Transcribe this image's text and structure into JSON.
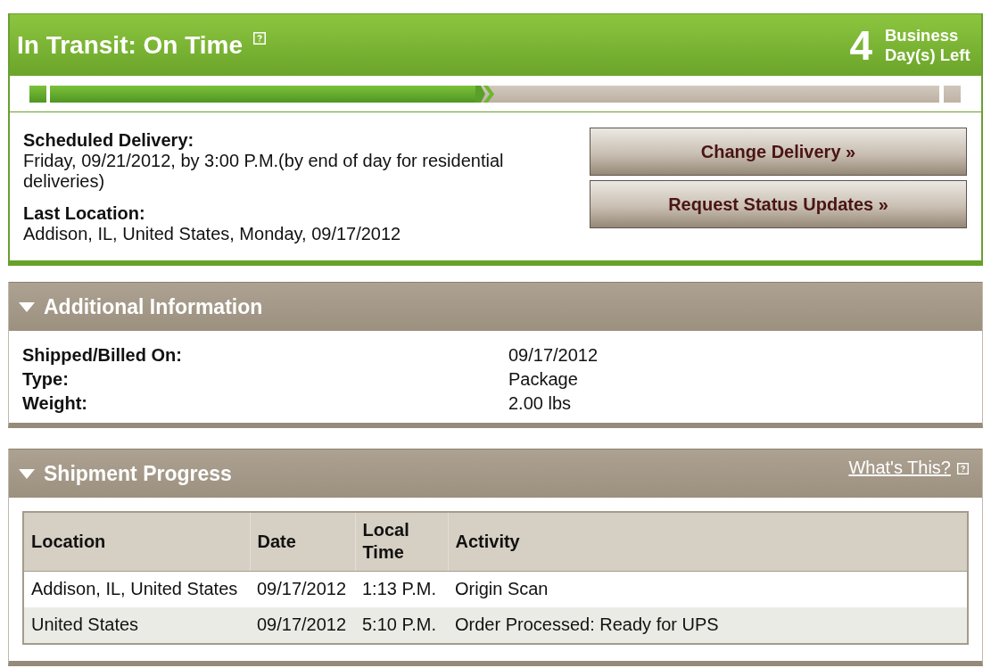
{
  "status": {
    "title": "In Transit: On Time",
    "days_left": "4",
    "days_left_label": "Business Day(s) Left"
  },
  "progress": {
    "level": 0.5
  },
  "scheduled_delivery": {
    "label": "Scheduled Delivery:",
    "value": "Friday, 09/21/2012, by 3:00 P.M.(by end of day for residential deliveries)"
  },
  "last_location": {
    "label": "Last Location:",
    "value": "Addison, IL, United States, Monday, 09/17/2012"
  },
  "buttons": [
    "Change Delivery »",
    "Request Status Updates »"
  ],
  "additional_information": {
    "title": "Additional Information",
    "expanded": true,
    "fields": [
      {
        "label": "Shipped/Billed On:",
        "value": "09/17/2012"
      },
      {
        "label": "Type:",
        "value": "Package"
      },
      {
        "label": "Weight:",
        "value": "2.00 lbs"
      }
    ]
  },
  "shipment_progress": {
    "title": "Shipment Progress",
    "expanded": true,
    "help_link": "What's This?",
    "table": {
      "columns": [
        "Location",
        "Date",
        "Local Time",
        "Activity"
      ],
      "rows": [
        [
          "Addison, IL, United States",
          "09/17/2012",
          "1:13 P.M.",
          "Origin Scan"
        ],
        [
          "United States",
          "09/17/2012",
          "5:10 P.M.",
          "Order Processed: Ready for UPS"
        ]
      ]
    }
  }
}
